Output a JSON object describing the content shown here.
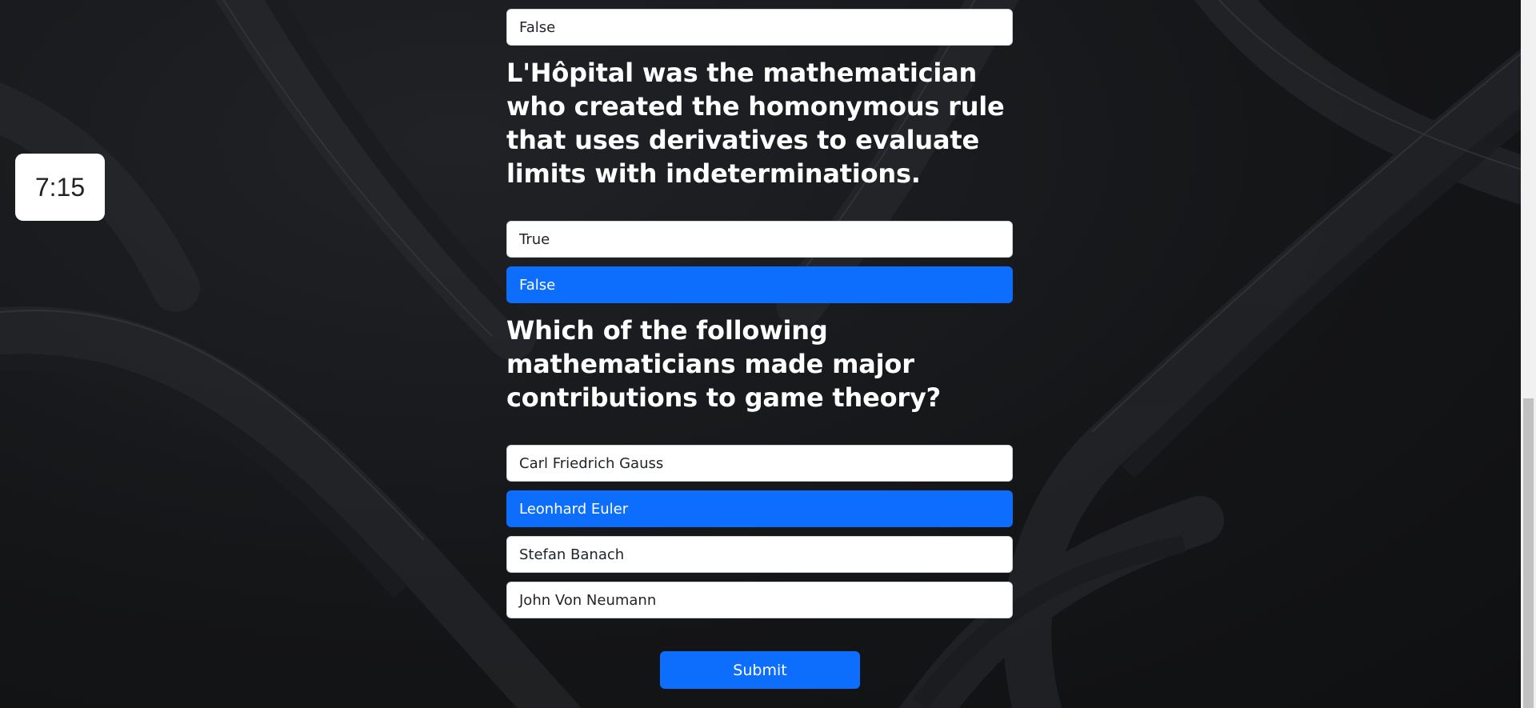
{
  "timer": {
    "value": "7:15"
  },
  "quiz": {
    "prev_question": {
      "options": [
        {
          "label": "False",
          "selected": false
        }
      ]
    },
    "questions": [
      {
        "text": "L'Hôpital was the mathematician who created the homonymous rule that uses derivatives to evaluate limits with indeterminations.",
        "options": [
          {
            "label": "True",
            "selected": false
          },
          {
            "label": "False",
            "selected": true
          }
        ]
      },
      {
        "text": "Which of the following mathematicians made major contributions to game theory?",
        "options": [
          {
            "label": "Carl Friedrich Gauss",
            "selected": false
          },
          {
            "label": "Leonhard Euler",
            "selected": true
          },
          {
            "label": "Stefan Banach",
            "selected": false
          },
          {
            "label": "John Von Neumann",
            "selected": false
          }
        ]
      }
    ],
    "submit_label": "Submit"
  },
  "colors": {
    "accent": "#0d6efd",
    "background": "#151619",
    "option_bg": "#ffffff",
    "text_light": "#ffffff"
  }
}
